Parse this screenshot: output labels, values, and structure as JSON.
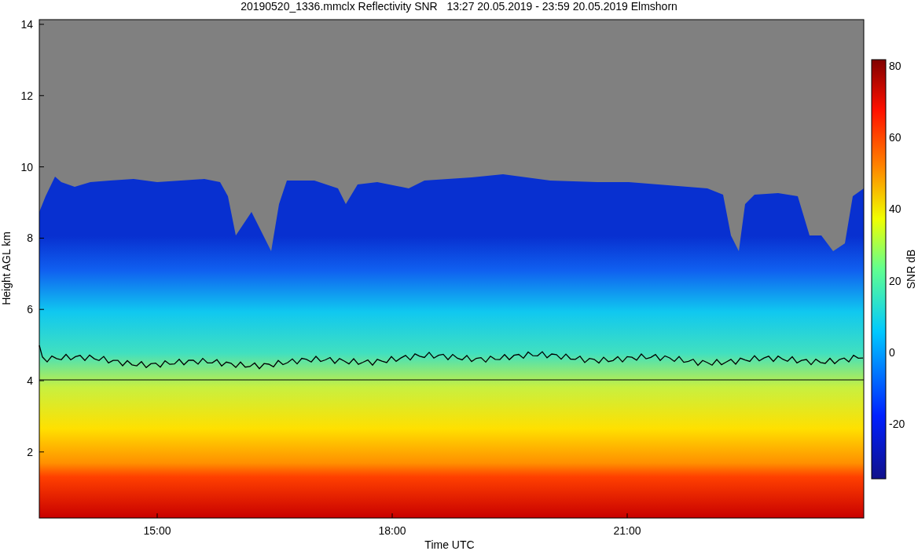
{
  "title": "20190520_1336.mmclx Reflectivity SNR   13:27 20.05.2019 - 23:59 20.05.2019 Elmshorn",
  "y_axis": {
    "label": "Height AGL km",
    "ticks": [
      "14",
      "12",
      "10",
      "8",
      "6",
      "4",
      "2"
    ]
  },
  "x_axis": {
    "label": "Time UTC",
    "ticks": [
      "15:00",
      "18:00",
      "21:00"
    ]
  },
  "colorbar": {
    "label": "SNR dB",
    "ticks": [
      "80",
      "60",
      "40",
      "20",
      "0",
      "-20"
    ]
  }
}
